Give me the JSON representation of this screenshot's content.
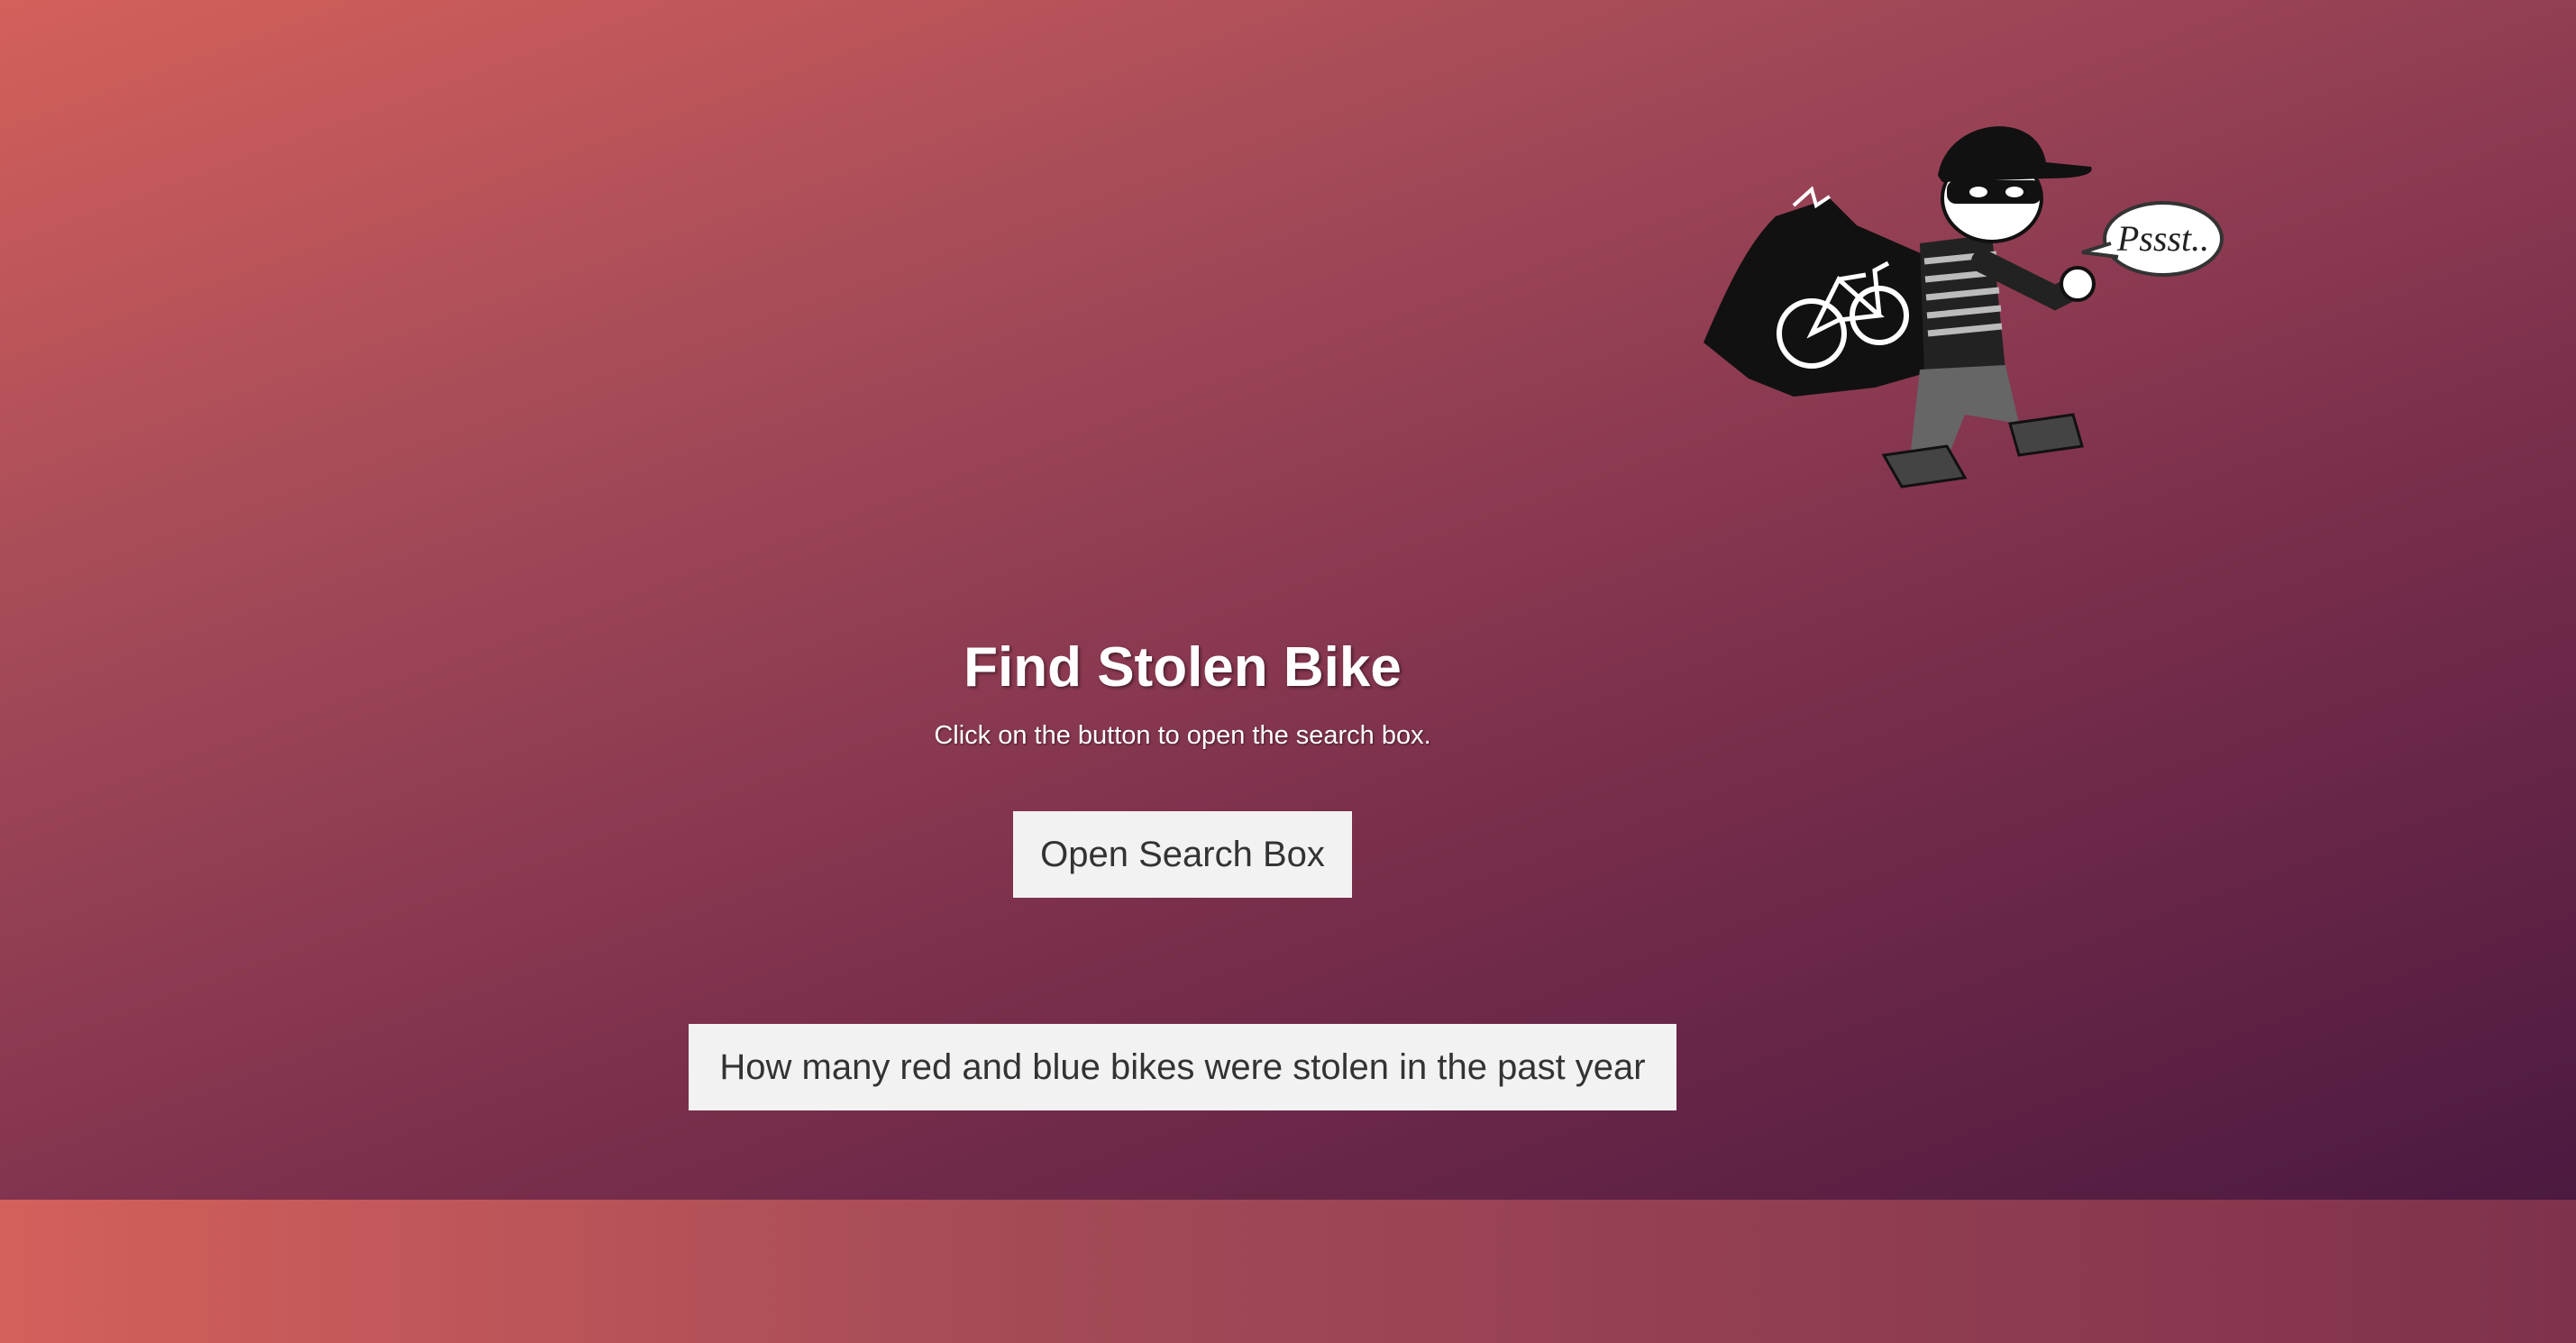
{
  "hero": {
    "title": "Find Stolen Bike",
    "subtitle": "Click on the button to open the search box.",
    "open_button_label": "Open Search Box",
    "query_button_label": "How many red and blue bikes were stolen in the past year"
  },
  "illustration": {
    "icon": "bike-thief-illustration",
    "speech_bubble_text": "Pssst.."
  },
  "colors": {
    "gradient_start": "#d4605b",
    "gradient_end": "#4c1940",
    "button_bg": "#f2f2f2",
    "button_text": "#333333"
  }
}
